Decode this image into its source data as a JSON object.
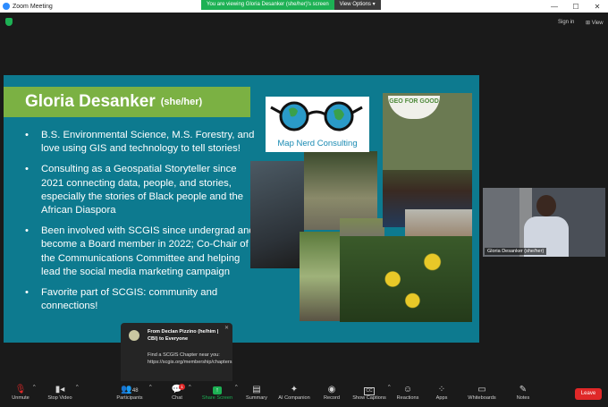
{
  "window": {
    "title": "Zoom Meeting"
  },
  "share_banner": {
    "message": "You are viewing Gloria Desanker (she/her)'s screen",
    "options_label": "View Options"
  },
  "top_right": {
    "sign_in": "Sign in",
    "view": "View"
  },
  "slide": {
    "name": "Gloria Desanker",
    "pronouns": "(she/her)",
    "bullets": [
      "B.S. Environmental Science, M.S. Forestry, and love using GIS and technology to tell stories!",
      "Consulting as a Geospatial Storyteller since 2021 connecting data, people, and stories, especially the stories of Black people and the African Diaspora",
      "Been involved with SCGIS since undergrad and become a Board member in 2022; Co-Chair of the Communications Committee and helping lead the social media marketing campaign",
      "Favorite part of SCGIS: community and connections!"
    ],
    "logo_text": "Map Nerd Consulting",
    "geo_badge": "GEO FOR GOOD"
  },
  "chat_toast": {
    "header": "From Declan Pizzino (he/him | CBI) to Everyone",
    "message": "Find a SCGIS Chapter near you: https://scgis.org/membership/chapters"
  },
  "participant_tile": {
    "name": "Gloria Desanker (she/her)"
  },
  "toolbar": {
    "unmute": "Unmute",
    "stop_video": "Stop Video",
    "participants": "Participants",
    "participants_count": "48",
    "chat": "Chat",
    "chat_badge": "1",
    "share_screen": "Share Screen",
    "summary": "Summary",
    "ai_companion": "AI Companion",
    "record": "Record",
    "show_captions": "Show Captions",
    "reactions": "Reactions",
    "apps": "Apps",
    "whiteboards": "Whiteboards",
    "notes": "Notes",
    "leave": "Leave"
  },
  "colors": {
    "slide_bg": "#0d7a8f",
    "name_bar": "#7bb143",
    "share_green": "#1db154",
    "leave_red": "#e02828"
  }
}
